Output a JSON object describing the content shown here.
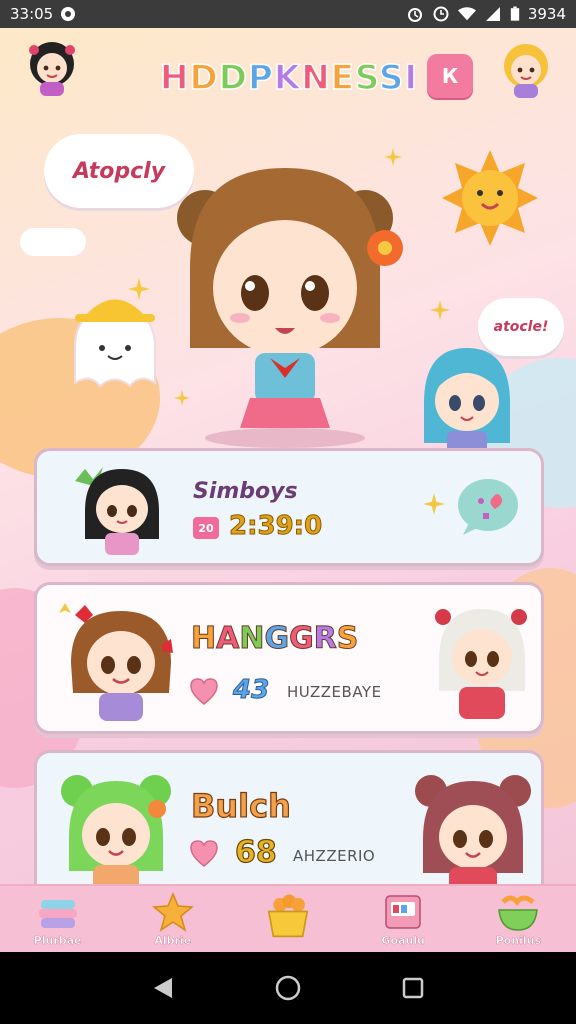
{
  "status_bar": {
    "time": "33:05",
    "battery_text": "3934",
    "icons": [
      "notification-icon",
      "alarm-icon",
      "clock-icon",
      "wifi-icon",
      "signal-icon",
      "battery-icon"
    ]
  },
  "header": {
    "title": "HDDPKNESSI",
    "title_letters": [
      "H",
      "D",
      "D",
      "P",
      "K",
      "N",
      "E",
      "S",
      "S",
      "I"
    ],
    "title_colors": [
      "#f05b7c",
      "#f7a33b",
      "#7ccc5a",
      "#5aa6e8",
      "#b57be8",
      "#f05b7c",
      "#f7a33b",
      "#7ccc5a",
      "#5aa6e8",
      "#b57be8"
    ],
    "menu_button_label": "К"
  },
  "hero": {
    "speech_left": "Atopcly",
    "speech_right": "atocle!"
  },
  "cards": [
    {
      "title": "Simboys",
      "chip": "20",
      "time": "2:39:0"
    },
    {
      "title": "HANGGRS",
      "title_colors": [
        "#f7a33b",
        "#f05b7c",
        "#7ccc5a",
        "#5aa6e8",
        "#f05b7c",
        "#b57be8",
        "#f7a33b"
      ],
      "badge": "43",
      "sub": "HUZZEBAYE"
    },
    {
      "title": "Bulch",
      "count": "68",
      "sub": "AHZZERIO"
    }
  ],
  "bottom_nav": [
    {
      "label": "Plurbae",
      "icon": "cake-icon"
    },
    {
      "label": "Albrie",
      "icon": "star-icon"
    },
    {
      "label": "",
      "icon": "basket-icon"
    },
    {
      "label": "Goaulu",
      "icon": "book-icon"
    },
    {
      "label": "Ponilus",
      "icon": "bowl-icon"
    }
  ],
  "colors": {
    "accent_pink": "#f47ba0",
    "card_border": "#d9b7c8",
    "nav_bg": "#f6bfd3"
  }
}
